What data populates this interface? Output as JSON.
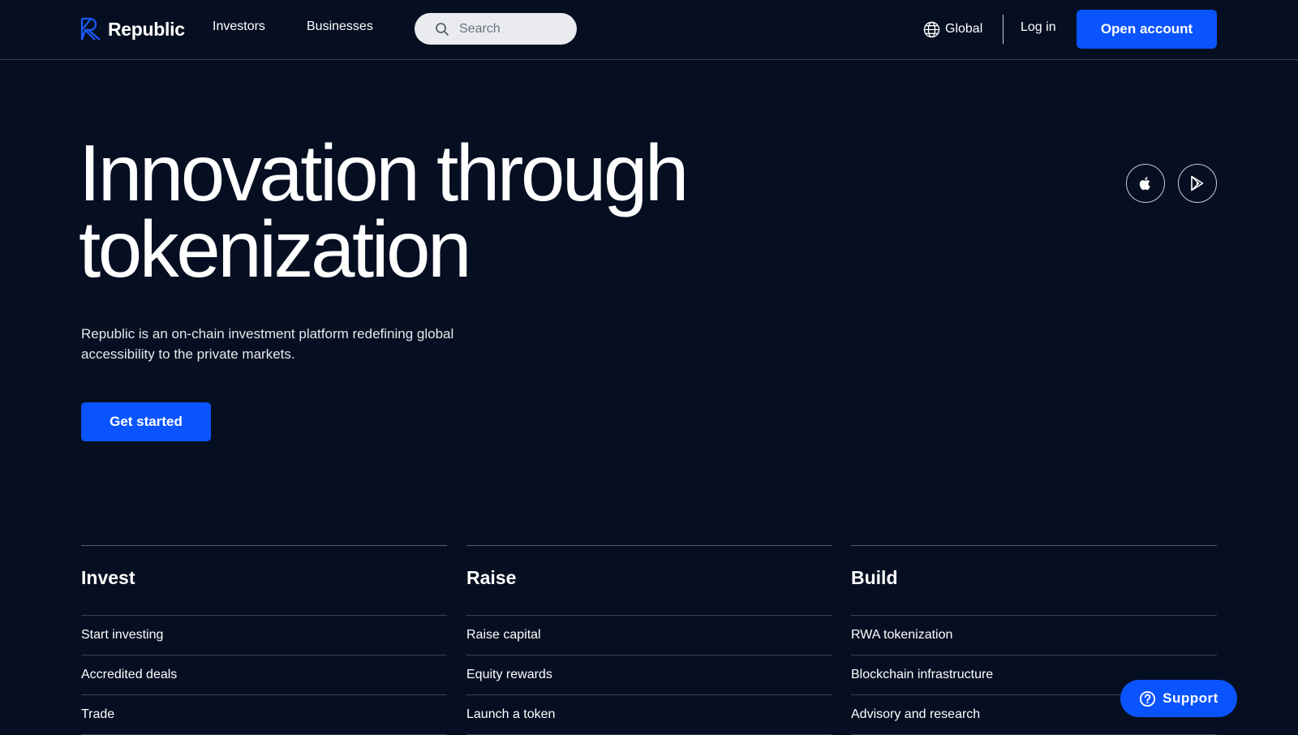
{
  "header": {
    "brand": "Republic",
    "nav": [
      "Investors",
      "Businesses"
    ],
    "search_placeholder": "Search",
    "region_label": "Global",
    "login_label": "Log in",
    "cta_label": "Open account"
  },
  "hero": {
    "title_line1": "Innovation through",
    "title_line2": "tokenization",
    "subtitle": "Republic is an on-chain investment platform redefining global accessibility to the private markets.",
    "cta_label": "Get started",
    "store_icons": [
      "apple-icon",
      "google-play-icon"
    ]
  },
  "columns": [
    {
      "heading": "Invest",
      "items": [
        "Start investing",
        "Accredited deals",
        "Trade"
      ]
    },
    {
      "heading": "Raise",
      "items": [
        "Raise capital",
        "Equity rewards",
        "Launch a token"
      ]
    },
    {
      "heading": "Build",
      "items": [
        "RWA tokenization",
        "Blockchain infrastructure",
        "Advisory and research"
      ]
    }
  ],
  "support": {
    "label": "Support"
  },
  "colors": {
    "background": "#060f21",
    "accent": "#0a54ff"
  }
}
